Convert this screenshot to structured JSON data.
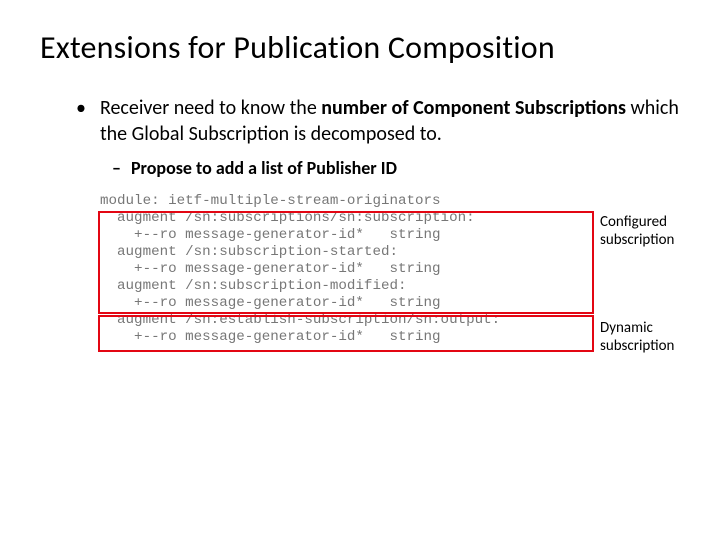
{
  "title": "Extensions for Publication Composition",
  "bullet1_pre": "Receiver need to know the ",
  "bullet1_bold": "number of Component Subscriptions",
  "bullet1_post": " which the Global Subscription is decomposed to.",
  "bullet2": "Propose to add a list of Publisher ID",
  "code_lines": [
    "module: ietf-multiple-stream-originators",
    "  augment /sn:subscriptions/sn:subscription:",
    "    +--ro message-generator-id*   string",
    "  augment /sn:subscription-started:",
    "    +--ro message-generator-id*   string",
    "  augment /sn:subscription-modified:",
    "    +--ro message-generator-id*   string",
    "  augment /sn:establish-subscription/sn:output:",
    "    +--ro message-generator-id*   string"
  ],
  "annotation_top": "Configured\nsubscription",
  "annotation_bottom": "Dynamic\nsubscription"
}
